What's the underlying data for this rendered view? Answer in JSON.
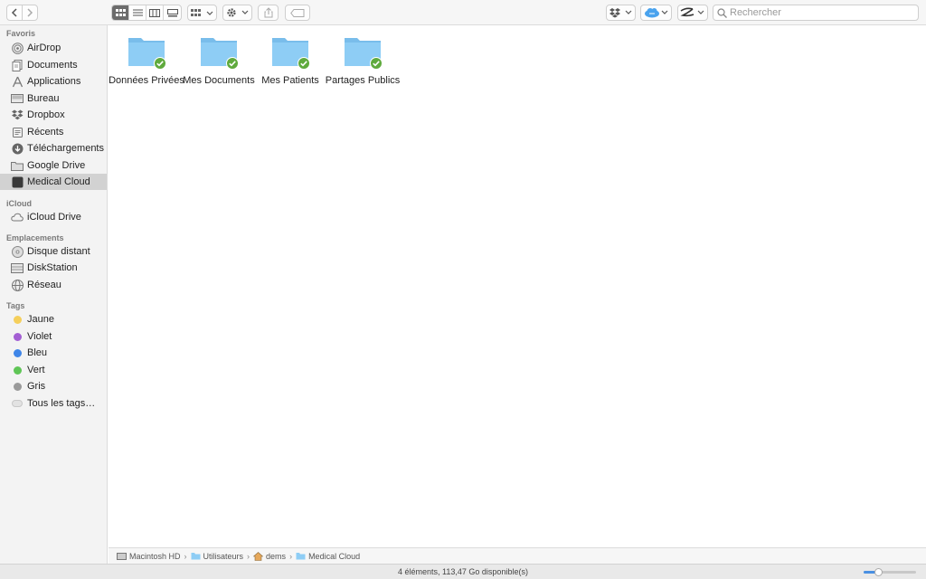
{
  "toolbar": {
    "search_placeholder": "Rechercher"
  },
  "sidebar": {
    "sections": [
      {
        "title": "Favoris",
        "items": [
          {
            "label": "AirDrop",
            "icon": "airdrop-icon"
          },
          {
            "label": "Documents",
            "icon": "documents-icon"
          },
          {
            "label": "Applications",
            "icon": "applications-icon"
          },
          {
            "label": "Bureau",
            "icon": "desktop-icon"
          },
          {
            "label": "Dropbox",
            "icon": "dropbox-icon"
          },
          {
            "label": "Récents",
            "icon": "recents-icon"
          },
          {
            "label": "Téléchargements",
            "icon": "downloads-icon"
          },
          {
            "label": "Google Drive",
            "icon": "folder-icon"
          },
          {
            "label": "Medical Cloud",
            "icon": "medical-cloud-icon",
            "selected": true
          }
        ]
      },
      {
        "title": "iCloud",
        "items": [
          {
            "label": "iCloud Drive",
            "icon": "icloud-icon"
          }
        ]
      },
      {
        "title": "Emplacements",
        "items": [
          {
            "label": "Disque distant",
            "icon": "disc-icon"
          },
          {
            "label": "DiskStation",
            "icon": "server-icon"
          },
          {
            "label": "Réseau",
            "icon": "network-icon"
          }
        ]
      },
      {
        "title": "Tags",
        "items": [
          {
            "label": "Jaune",
            "color": "#f5cf5b"
          },
          {
            "label": "Violet",
            "color": "#a35fd3"
          },
          {
            "label": "Bleu",
            "color": "#3f86e8"
          },
          {
            "label": "Vert",
            "color": "#5fc556"
          },
          {
            "label": "Gris",
            "color": "#9a9a9a"
          },
          {
            "label": "Tous les tags…",
            "color": "#e2e2e2"
          }
        ]
      }
    ]
  },
  "folders": [
    {
      "name": "Données Privées",
      "synced": true
    },
    {
      "name": "Mes Documents",
      "synced": true
    },
    {
      "name": "Mes Patients",
      "synced": true
    },
    {
      "name": "Partages Publics",
      "synced": true
    }
  ],
  "pathbar": {
    "crumbs": [
      {
        "label": "Macintosh HD",
        "icon": "hard-drive-icon"
      },
      {
        "label": "Utilisateurs",
        "icon": "folder-icon"
      },
      {
        "label": "dems",
        "icon": "home-icon"
      },
      {
        "label": "Medical Cloud",
        "icon": "folder-icon"
      }
    ],
    "separator": "›"
  },
  "status": {
    "text": "4 éléments, 113,47 Go disponible(s)",
    "zoom_fraction": 0.25
  },
  "colors": {
    "folder": "#8ecdf5",
    "folder_tab": "#79bdeb",
    "sync_check": "#5faa3d",
    "selection": "#d2d2d2"
  }
}
